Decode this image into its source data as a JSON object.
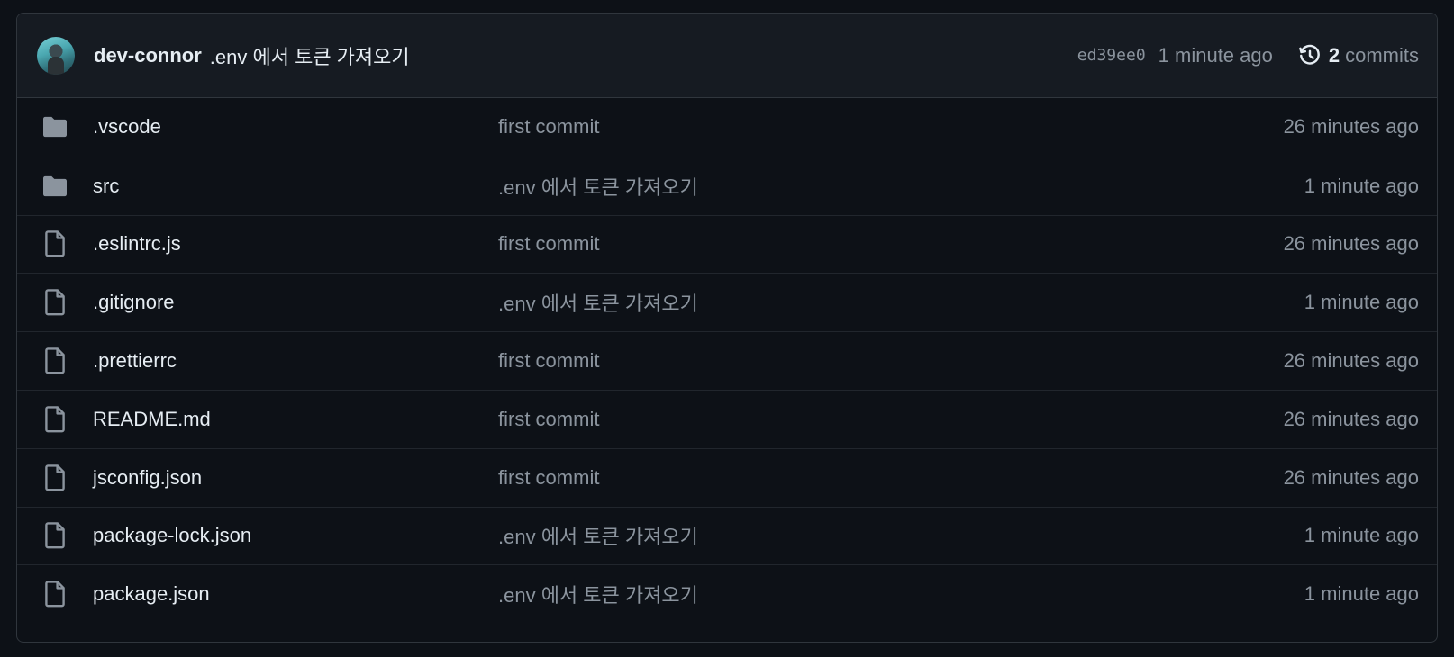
{
  "latest_commit": {
    "author": "dev-connor",
    "message": ".env 에서 토큰 가져오기",
    "sha": "ed39ee0",
    "time": "1 minute ago",
    "commit_count": "2",
    "commits_label": "commits",
    "avatar_icon": "user-avatar",
    "history_icon": "history-icon"
  },
  "files": [
    {
      "type": "folder",
      "icon": "folder-icon",
      "name": ".vscode",
      "message": "first commit",
      "age": "26 minutes ago"
    },
    {
      "type": "folder",
      "icon": "folder-icon",
      "name": "src",
      "message": ".env 에서 토큰 가져오기",
      "age": "1 minute ago"
    },
    {
      "type": "file",
      "icon": "file-icon",
      "name": ".eslintrc.js",
      "message": "first commit",
      "age": "26 minutes ago"
    },
    {
      "type": "file",
      "icon": "file-icon",
      "name": ".gitignore",
      "message": ".env 에서 토큰 가져오기",
      "age": "1 minute ago"
    },
    {
      "type": "file",
      "icon": "file-icon",
      "name": ".prettierrc",
      "message": "first commit",
      "age": "26 minutes ago"
    },
    {
      "type": "file",
      "icon": "file-icon",
      "name": "README.md",
      "message": "first commit",
      "age": "26 minutes ago"
    },
    {
      "type": "file",
      "icon": "file-icon",
      "name": "jsconfig.json",
      "message": "first commit",
      "age": "26 minutes ago"
    },
    {
      "type": "file",
      "icon": "file-icon",
      "name": "package-lock.json",
      "message": ".env 에서 토큰 가져오기",
      "age": "1 minute ago"
    },
    {
      "type": "file",
      "icon": "file-icon",
      "name": "package.json",
      "message": ".env 에서 토큰 가져오기",
      "age": "1 minute ago"
    }
  ],
  "colors": {
    "background": "#0d1117",
    "header_background": "#161b22",
    "border": "#30363d",
    "text_primary": "#e6edf3",
    "text_muted": "#8b949e",
    "icon": "#8b949e"
  }
}
